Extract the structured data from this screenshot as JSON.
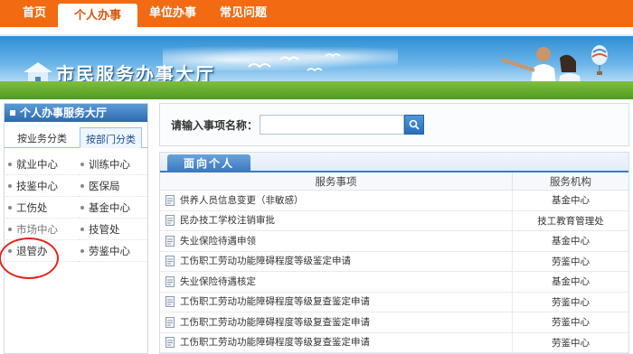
{
  "topnav": {
    "items": [
      {
        "label": "首页"
      },
      {
        "label": "个人办事"
      },
      {
        "label": "单位办事"
      },
      {
        "label": "常见问题"
      }
    ],
    "active_index": 1
  },
  "banner": {
    "title": "市民服务办事大厅"
  },
  "left_panel": {
    "header": "个人办事服务大厅",
    "tabs": [
      "按业务分类",
      "按部门分类"
    ],
    "active_tab": "按部门分类",
    "departments": [
      [
        "就业中心",
        "训练中心"
      ],
      [
        "技鉴中心",
        "医保局"
      ],
      [
        "工伤处",
        "基金中心"
      ],
      [
        "市场中心",
        "技管处"
      ],
      [
        "退管办",
        "劳鉴中心"
      ]
    ]
  },
  "search": {
    "label": "请输入事项名称：",
    "value": "",
    "placeholder": ""
  },
  "services": {
    "tab_label": "面向个人",
    "columns": [
      "服务事项",
      "服务机构"
    ],
    "rows": [
      {
        "item": "供养人员信息变更（非敏感）",
        "agency": "基金中心"
      },
      {
        "item": "民办技工学校注销审批",
        "agency": "技工教育管理处"
      },
      {
        "item": "失业保险待遇申领",
        "agency": "基金中心"
      },
      {
        "item": "工伤职工劳动功能障碍程度等级鉴定申请",
        "agency": "劳鉴中心"
      },
      {
        "item": "失业保险待遇核定",
        "agency": "基金中心"
      },
      {
        "item": "工伤职工劳动功能障碍程度等级复查鉴定申请",
        "agency": "劳鉴中心"
      },
      {
        "item": "工伤职工劳动功能障碍程度等级复查鉴定申请",
        "agency": "劳鉴中心"
      },
      {
        "item": "工伤职工劳动功能障碍程度等级复查鉴定申请",
        "agency": "劳鉴中心"
      }
    ]
  },
  "colors": {
    "nav_orange": "#f26a12",
    "accent_blue": "#3b7ac2",
    "highlight_red": "#e0261e"
  }
}
